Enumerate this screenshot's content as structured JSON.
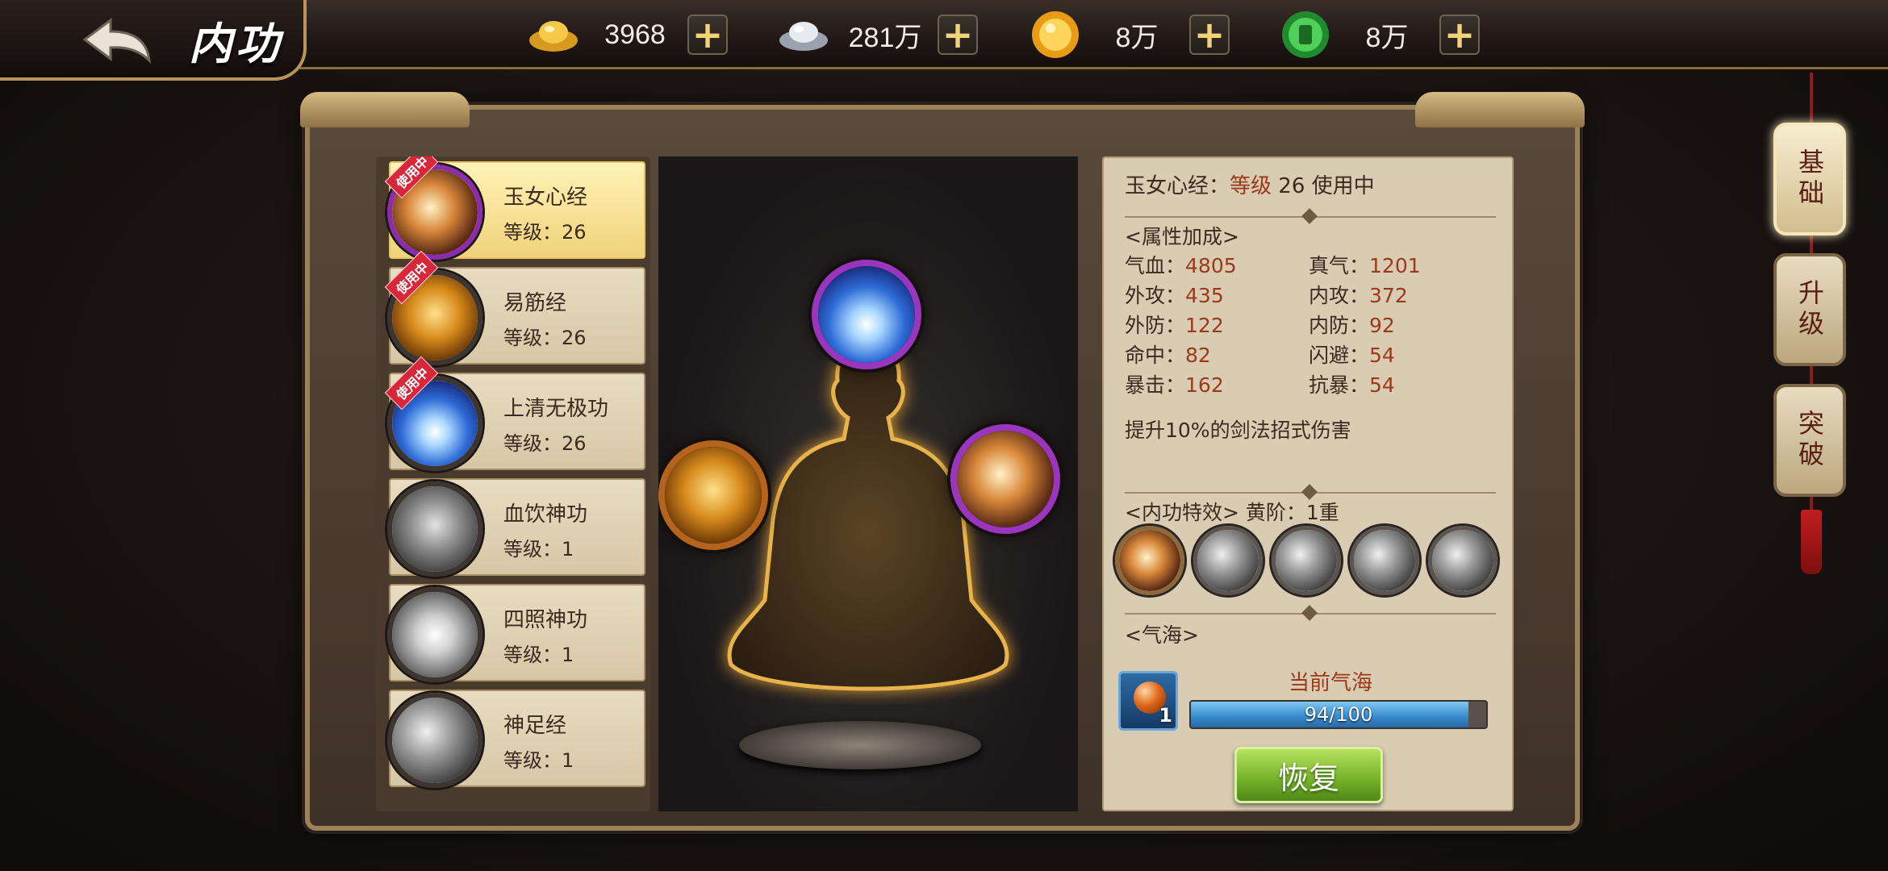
{
  "header": {
    "title": "内功",
    "currencies": [
      {
        "icon": "gold-ingot-icon",
        "value": "3968"
      },
      {
        "icon": "silver-ingot-icon",
        "value": "281万"
      },
      {
        "icon": "gold-coin-icon",
        "value": "8万"
      },
      {
        "icon": "jade-coin-icon",
        "value": "8万"
      }
    ],
    "plus": "+"
  },
  "skills": [
    {
      "name": "玉女心经",
      "level_label": "等级：",
      "level": "26",
      "in_use": true,
      "tag": "使用中"
    },
    {
      "name": "易筋经",
      "level_label": "等级：",
      "level": "26",
      "in_use": true,
      "tag": "使用中"
    },
    {
      "name": "上清无极功",
      "level_label": "等级：",
      "level": "26",
      "in_use": true,
      "tag": "使用中"
    },
    {
      "name": "血饮神功",
      "level_label": "等级：",
      "level": "1",
      "in_use": false
    },
    {
      "name": "四照神功",
      "level_label": "等级：",
      "level": "1",
      "in_use": false
    },
    {
      "name": "神足经",
      "level_label": "等级：",
      "level": "1",
      "in_use": false
    }
  ],
  "detail": {
    "title_name": "玉女心经：",
    "title_level_word": "等级",
    "title_level": " 26 使用中",
    "attr_header": "<属性加成>",
    "stats": [
      {
        "label": "气血：",
        "value": "4805"
      },
      {
        "label": "真气：",
        "value": "1201"
      },
      {
        "label": "外攻：",
        "value": "435"
      },
      {
        "label": "内攻：",
        "value": "372"
      },
      {
        "label": "外防：",
        "value": "122"
      },
      {
        "label": "内防：",
        "value": "92"
      },
      {
        "label": "命中：",
        "value": "82"
      },
      {
        "label": "闪避：",
        "value": "54"
      },
      {
        "label": "暴击：",
        "value": "162"
      },
      {
        "label": "抗暴：",
        "value": "54"
      }
    ],
    "bonus_desc": "提升10%的剑法招式伤害",
    "effect_header": "<内功特效>  黄阶：1重",
    "qihai_header": "<气海>",
    "qihai_item_count": "1",
    "qihai_label": "当前气海",
    "qihai_progress": 0.94,
    "qihai_progress_text": "94/100",
    "restore_label": "恢复"
  },
  "tabs": [
    {
      "label": "基础",
      "active": true
    },
    {
      "label": "升级",
      "active": false
    },
    {
      "label": "突破",
      "active": false
    }
  ],
  "colors": {
    "stat_value": "#9a3a1c",
    "in_use_tag": "#d8263a",
    "progress_fill": "#3a8ed0",
    "restore_button": "#79b52c"
  }
}
